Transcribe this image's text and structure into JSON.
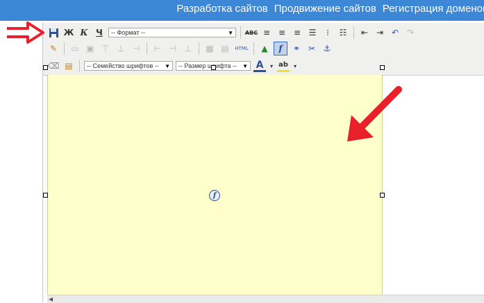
{
  "topnav": {
    "items": [
      "Разработка сайтов",
      "Продвижение сайтов",
      "Регистрация доменов"
    ]
  },
  "toolbar": {
    "bold_label": "Ж",
    "italic_label": "К",
    "underline_label": "Ч",
    "format_select": "-- Формат --",
    "font_family_select": "-- Семейство шрифтов --",
    "font_size_select": "-- Размер шрифта --",
    "html_label": "HTML",
    "strike_label": "ABC",
    "font_color_label": "A",
    "highlight_label": "ab"
  },
  "colors": {
    "topbar": "#3c87d6",
    "flash_bg": "#ffffcc",
    "annotation_arrow": "#e8202a"
  },
  "icons": [
    "save-icon",
    "bold-icon",
    "italic-icon",
    "underline-icon",
    "strikethrough-icon",
    "align-left-icon",
    "align-center-icon",
    "align-right-icon",
    "justify-icon",
    "bullet-list-icon",
    "numbered-list-icon",
    "outdent-icon",
    "indent-icon",
    "undo-icon",
    "redo-icon",
    "edit-icon",
    "flash-icon",
    "link-icon",
    "unlink-icon",
    "anchor-icon",
    "eraser-icon",
    "paste-word-icon"
  ]
}
